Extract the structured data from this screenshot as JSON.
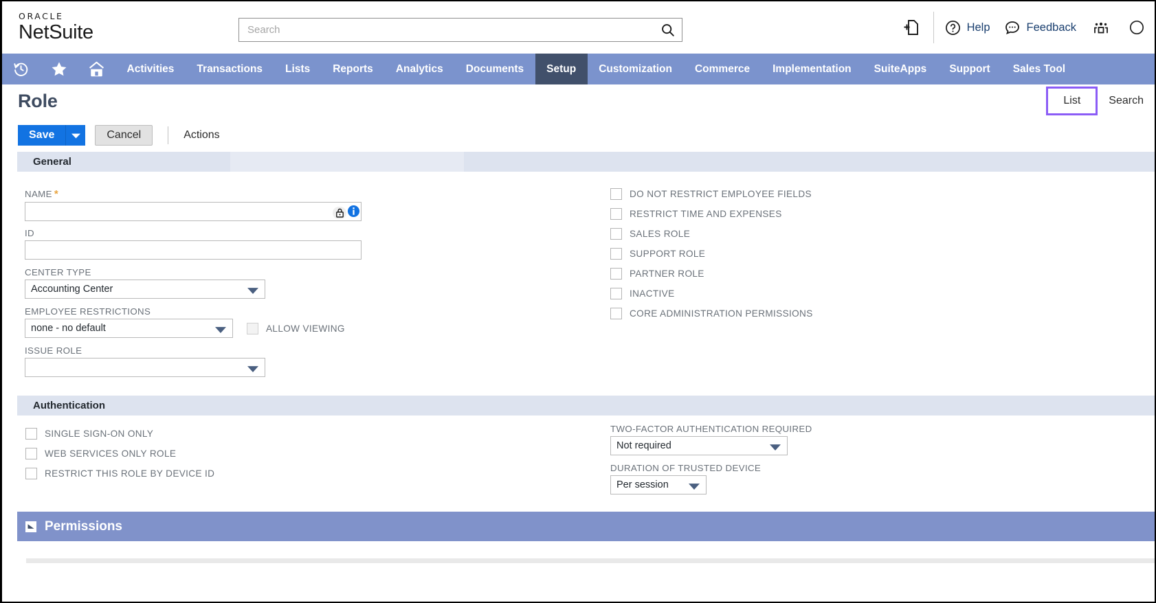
{
  "brand": {
    "oracle": "ORACLE",
    "product": "NetSuite"
  },
  "search": {
    "placeholder": "Search",
    "value": "",
    "icon": "search-icon"
  },
  "top_actions": {
    "new_doc_icon": "new-document-icon",
    "help_label": "Help",
    "help_icon": "question-circle-icon",
    "feedback_label": "Feedback",
    "feedback_icon": "chat-bubble-icon",
    "people_icon": "people-group-icon"
  },
  "nav": {
    "icons": [
      "recent-history-icon",
      "favorites-star-icon",
      "home-icon"
    ],
    "items": [
      {
        "label": "Activities",
        "active": false
      },
      {
        "label": "Transactions",
        "active": false
      },
      {
        "label": "Lists",
        "active": false
      },
      {
        "label": "Reports",
        "active": false
      },
      {
        "label": "Analytics",
        "active": false
      },
      {
        "label": "Documents",
        "active": false
      },
      {
        "label": "Setup",
        "active": true
      },
      {
        "label": "Customization",
        "active": false
      },
      {
        "label": "Commerce",
        "active": false
      },
      {
        "label": "Implementation",
        "active": false
      },
      {
        "label": "SuiteApps",
        "active": false
      },
      {
        "label": "Support",
        "active": false
      },
      {
        "label": "Sales Tool",
        "active": false
      }
    ]
  },
  "page": {
    "title": "Role",
    "list_label": "List",
    "search_label": "Search"
  },
  "toolbar": {
    "save_label": "Save",
    "save_caret": "chevron-down-icon",
    "cancel_label": "Cancel",
    "actions_label": "Actions"
  },
  "sections": {
    "general_title": "General",
    "authentication_title": "Authentication",
    "permissions_title": "Permissions"
  },
  "general": {
    "name_label": "NAME",
    "name_required": "*",
    "name_value": "",
    "name_lock_icon": "lock-icon",
    "name_info_icon": "info-circle-icon",
    "id_label": "ID",
    "id_value": "",
    "center_type_label": "CENTER TYPE",
    "center_type_value": "Accounting Center",
    "employee_restrictions_label": "EMPLOYEE RESTRICTIONS",
    "employee_restrictions_value": "none - no default",
    "allow_viewing_label": "ALLOW VIEWING",
    "allow_viewing_checked": false,
    "issue_role_label": "ISSUE ROLE",
    "issue_role_value": "",
    "checkboxes": [
      {
        "label": "DO NOT RESTRICT EMPLOYEE FIELDS",
        "checked": false
      },
      {
        "label": "RESTRICT TIME AND EXPENSES",
        "checked": false
      },
      {
        "label": "SALES ROLE",
        "checked": false
      },
      {
        "label": "SUPPORT ROLE",
        "checked": false
      },
      {
        "label": "PARTNER ROLE",
        "checked": false
      },
      {
        "label": "INACTIVE",
        "checked": false
      },
      {
        "label": "CORE ADMINISTRATION PERMISSIONS",
        "checked": false
      }
    ]
  },
  "authentication": {
    "checkboxes": [
      {
        "label": "SINGLE SIGN-ON ONLY",
        "checked": false
      },
      {
        "label": "WEB SERVICES ONLY ROLE",
        "checked": false
      },
      {
        "label": "RESTRICT THIS ROLE BY DEVICE ID",
        "checked": false
      }
    ],
    "two_factor_label": "TWO-FACTOR AUTHENTICATION REQUIRED",
    "two_factor_value": "Not required",
    "duration_label": "DURATION OF TRUSTED DEVICE",
    "duration_value": "Per session"
  },
  "colors": {
    "nav_bg": "#7b93cd",
    "nav_active": "#41506b",
    "save_blue": "#1273e2",
    "section_head": "#dde3ef",
    "permissions_bar": "#8092ca",
    "highlight_box": "#8b5cf6",
    "required_star": "#e8a33d"
  }
}
